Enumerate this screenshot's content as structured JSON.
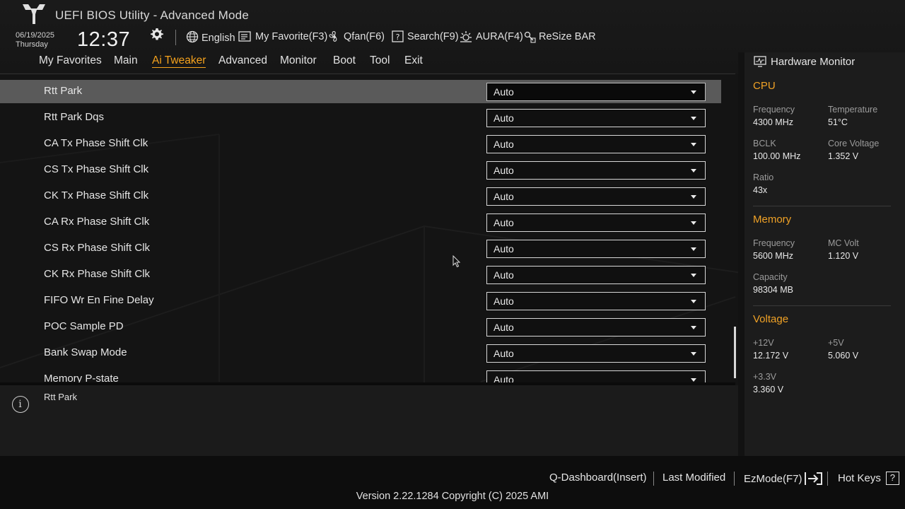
{
  "header": {
    "title": "UEFI BIOS Utility - Advanced Mode",
    "date": "06/19/2025",
    "day": "Thursday",
    "time": "12:37"
  },
  "toolbar": {
    "language": "English",
    "my_favorite": "My Favorite(F3)",
    "qfan": "Qfan(F6)",
    "search": "Search(F9)",
    "aura": "AURA(F4)",
    "resize_bar": "ReSize BAR"
  },
  "menu": {
    "items": [
      "My Favorites",
      "Main",
      "Ai Tweaker",
      "Advanced",
      "Monitor",
      "Boot",
      "Tool",
      "Exit"
    ],
    "active": "Ai Tweaker"
  },
  "settings": [
    {
      "label": "Rtt Park",
      "value": "Auto",
      "selected": true
    },
    {
      "label": "Rtt Park Dqs",
      "value": "Auto"
    },
    {
      "label": "CA Tx Phase Shift Clk",
      "value": "Auto"
    },
    {
      "label": "CS Tx Phase Shift Clk",
      "value": "Auto"
    },
    {
      "label": "CK Tx Phase Shift Clk",
      "value": "Auto"
    },
    {
      "label": "CA Rx Phase Shift Clk",
      "value": "Auto"
    },
    {
      "label": "CS Rx Phase Shift Clk",
      "value": "Auto"
    },
    {
      "label": "CK Rx Phase Shift Clk",
      "value": "Auto"
    },
    {
      "label": "FIFO Wr En Fine Delay",
      "value": "Auto"
    },
    {
      "label": "POC Sample PD",
      "value": "Auto"
    },
    {
      "label": "Bank Swap Mode",
      "value": "Auto"
    },
    {
      "label": "Memory P-state",
      "value": "Auto"
    }
  ],
  "description": "Rtt Park",
  "hardware_monitor": {
    "title": "Hardware Monitor",
    "cpu": {
      "heading": "CPU",
      "frequency_label": "Frequency",
      "frequency": "4300 MHz",
      "temperature_label": "Temperature",
      "temperature": "51°C",
      "bclk_label": "BCLK",
      "bclk": "100.00 MHz",
      "core_voltage_label": "Core Voltage",
      "core_voltage": "1.352 V",
      "ratio_label": "Ratio",
      "ratio": "43x"
    },
    "memory": {
      "heading": "Memory",
      "frequency_label": "Frequency",
      "frequency": "5600 MHz",
      "mc_volt_label": "MC Volt",
      "mc_volt": "1.120 V",
      "capacity_label": "Capacity",
      "capacity": "98304 MB"
    },
    "voltage": {
      "heading": "Voltage",
      "v12_label": "+12V",
      "v12": "12.172 V",
      "v5_label": "+5V",
      "v5": "5.060 V",
      "v33_label": "+3.3V",
      "v33": "3.360 V"
    }
  },
  "footer": {
    "q_dashboard": "Q-Dashboard(Insert)",
    "last_modified": "Last Modified",
    "ezmode": "EzMode(F7)",
    "hot_keys": "Hot Keys",
    "hot_keys_icon": "?",
    "version": "Version 2.22.1284 Copyright (C) 2025 AMI"
  },
  "colors": {
    "accent": "#f5a21d",
    "background": "#141414",
    "selected_row": "#5a5a5a"
  },
  "icons": [
    "tuf-logo-icon",
    "gear-icon",
    "globe-icon",
    "favorite-icon",
    "fan-icon",
    "search-icon",
    "aura-icon",
    "resize-bar-icon",
    "info-icon",
    "monitor-icon",
    "exit-arrow-icon",
    "help-icon"
  ]
}
